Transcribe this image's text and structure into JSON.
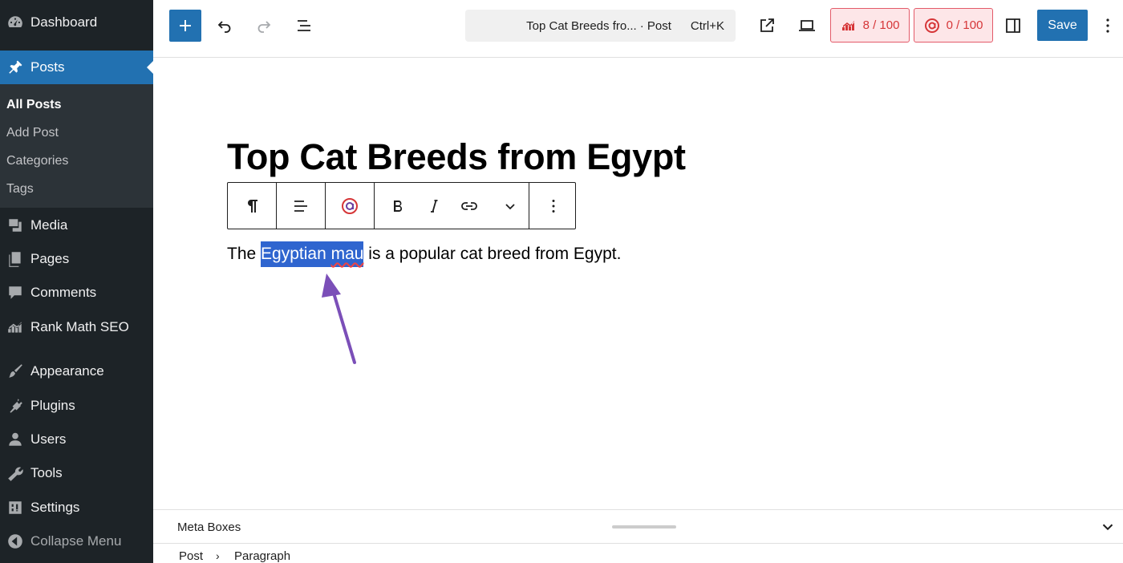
{
  "sidebar": {
    "items": [
      {
        "label": "Dashboard",
        "icon": "dashboard-icon"
      },
      {
        "label": "Posts",
        "icon": "pin-icon"
      },
      {
        "label": "Media",
        "icon": "media-icon"
      },
      {
        "label": "Pages",
        "icon": "pages-icon"
      },
      {
        "label": "Comments",
        "icon": "comments-icon"
      },
      {
        "label": "Rank Math SEO",
        "icon": "rank-math-icon"
      },
      {
        "label": "Appearance",
        "icon": "paintbrush-icon"
      },
      {
        "label": "Plugins",
        "icon": "plugins-icon"
      },
      {
        "label": "Users",
        "icon": "users-icon"
      },
      {
        "label": "Tools",
        "icon": "wrench-icon"
      },
      {
        "label": "Settings",
        "icon": "settings-icon"
      },
      {
        "label": "Collapse Menu",
        "icon": "collapse-icon"
      }
    ],
    "submenu": [
      {
        "label": "All Posts"
      },
      {
        "label": "Add Post"
      },
      {
        "label": "Categories"
      },
      {
        "label": "Tags"
      }
    ],
    "accent_color": "#2271b1"
  },
  "header": {
    "command_bar": {
      "title": "Top Cat Breeds fro...",
      "type": "· Post",
      "shortcut": "Ctrl+K"
    },
    "seo_score": "8 / 100",
    "content_ai_score": "0 / 100",
    "save_label": "Save"
  },
  "editor": {
    "post_title": "Top Cat Breeds from Egypt",
    "paragraph": {
      "before": "The ",
      "selected_1": "Egyptian ",
      "selected_2": "mau",
      "after": " is a popular cat breed from Egypt."
    },
    "selection_color": "#2f65cf",
    "annotation_color": "#7b4fb8"
  },
  "footer": {
    "meta_boxes_label": "Meta Boxes",
    "breadcrumb": {
      "root": "Post",
      "separator": "›",
      "current": "Paragraph"
    }
  }
}
